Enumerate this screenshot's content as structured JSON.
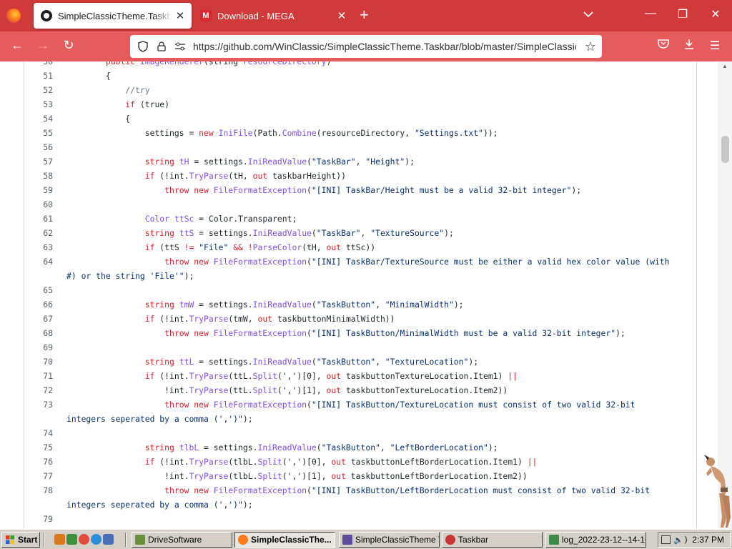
{
  "browser": {
    "tabs": [
      {
        "title": "SimpleClassicTheme.Taskbar/ImageRenderer",
        "active": true
      },
      {
        "title": "Download - MEGA",
        "active": false
      }
    ],
    "url": "https://github.com/WinClassic/SimpleClassicTheme.Taskbar/blob/master/SimpleClassicTheme.Taskbar/",
    "url_host": "https://github.com",
    "url_path": "/WinClassic/SimpleClassicTheme.Taskbar/blob/master/SimpleClassicTh"
  },
  "code": [
    {
      "n": "50",
      "segs": [
        [
          "        public ",
          "kw"
        ],
        [
          "ImageRenderer",
          "mt"
        ],
        [
          "(string ",
          "t"
        ],
        [
          "resourceDirectory",
          "ty"
        ],
        [
          ")",
          "t"
        ]
      ]
    },
    {
      "n": "51",
      "segs": [
        [
          "        {",
          "t"
        ]
      ]
    },
    {
      "n": "52",
      "segs": [
        [
          "            //try",
          "cm"
        ]
      ]
    },
    {
      "n": "53",
      "segs": [
        [
          "            ",
          "t"
        ],
        [
          "if",
          "kw"
        ],
        [
          " (true)",
          "t"
        ]
      ]
    },
    {
      "n": "54",
      "segs": [
        [
          "            {",
          "t"
        ]
      ]
    },
    {
      "n": "55",
      "segs": [
        [
          "                settings = ",
          "t"
        ],
        [
          "new ",
          "kw"
        ],
        [
          "IniFile",
          "mt"
        ],
        [
          "(Path.",
          "t"
        ],
        [
          "Combine",
          "mt"
        ],
        [
          "(resourceDirectory, ",
          "t"
        ],
        [
          "\"Settings.txt\"",
          "st"
        ],
        [
          "));",
          "t"
        ]
      ]
    },
    {
      "n": "56",
      "segs": []
    },
    {
      "n": "57",
      "segs": [
        [
          "                ",
          "t"
        ],
        [
          "string ",
          "kw"
        ],
        [
          "tH",
          "ty"
        ],
        [
          " = settings.",
          "t"
        ],
        [
          "IniReadValue",
          "mt"
        ],
        [
          "(",
          "t"
        ],
        [
          "\"TaskBar\"",
          "st"
        ],
        [
          ", ",
          "t"
        ],
        [
          "\"Height\"",
          "st"
        ],
        [
          ");",
          "t"
        ]
      ]
    },
    {
      "n": "58",
      "segs": [
        [
          "                ",
          "t"
        ],
        [
          "if",
          "kw"
        ],
        [
          " (!int.",
          "t"
        ],
        [
          "TryParse",
          "mt"
        ],
        [
          "(tH, ",
          "t"
        ],
        [
          "out ",
          "kw"
        ],
        [
          "taskbarHeight))",
          "t"
        ]
      ]
    },
    {
      "n": "59",
      "segs": [
        [
          "                    ",
          "t"
        ],
        [
          "throw new ",
          "kw"
        ],
        [
          "FileFormatException",
          "mt"
        ],
        [
          "(",
          "t"
        ],
        [
          "\"[INI] TaskBar/Height must be a valid 32-bit integer\"",
          "st"
        ],
        [
          ");",
          "t"
        ]
      ]
    },
    {
      "n": "60",
      "segs": []
    },
    {
      "n": "61",
      "segs": [
        [
          "                ",
          "t"
        ],
        [
          "Color ",
          "ty"
        ],
        [
          "ttSc",
          "ty"
        ],
        [
          " = Color.Transparent;",
          "t"
        ]
      ]
    },
    {
      "n": "62",
      "segs": [
        [
          "                ",
          "t"
        ],
        [
          "string ",
          "kw"
        ],
        [
          "ttS",
          "ty"
        ],
        [
          " = settings.",
          "t"
        ],
        [
          "IniReadValue",
          "mt"
        ],
        [
          "(",
          "t"
        ],
        [
          "\"TaskBar\"",
          "st"
        ],
        [
          ", ",
          "t"
        ],
        [
          "\"TextureSource\"",
          "st"
        ],
        [
          ");",
          "t"
        ]
      ]
    },
    {
      "n": "63",
      "segs": [
        [
          "                ",
          "t"
        ],
        [
          "if",
          "kw"
        ],
        [
          " (ttS ",
          "t"
        ],
        [
          "!=",
          "kw"
        ],
        [
          " ",
          "t"
        ],
        [
          "\"File\"",
          "st"
        ],
        [
          " ",
          "t"
        ],
        [
          "&&",
          "kw"
        ],
        [
          " ",
          "t"
        ],
        [
          "!",
          "kw"
        ],
        [
          "ParseColor",
          "mt"
        ],
        [
          "(tH, ",
          "t"
        ],
        [
          "out ",
          "kw"
        ],
        [
          "ttSc))",
          "t"
        ]
      ]
    },
    {
      "n": "64",
      "segs": [
        [
          "                    ",
          "t"
        ],
        [
          "throw new ",
          "kw"
        ],
        [
          "FileFormatException",
          "mt"
        ],
        [
          "(",
          "t"
        ],
        [
          "\"[INI] TaskBar/TextureSource must be either a valid hex color value (with",
          "st"
        ]
      ]
    },
    {
      "n": "",
      "segs": [
        [
          "#) or the string 'File'\"",
          "st"
        ],
        [
          ");",
          "t"
        ]
      ],
      "wrap": true
    },
    {
      "n": "65",
      "segs": []
    },
    {
      "n": "66",
      "segs": [
        [
          "                ",
          "t"
        ],
        [
          "string ",
          "kw"
        ],
        [
          "tmW",
          "ty"
        ],
        [
          " = settings.",
          "t"
        ],
        [
          "IniReadValue",
          "mt"
        ],
        [
          "(",
          "t"
        ],
        [
          "\"TaskButton\"",
          "st"
        ],
        [
          ", ",
          "t"
        ],
        [
          "\"MinimalWidth\"",
          "st"
        ],
        [
          ");",
          "t"
        ]
      ]
    },
    {
      "n": "67",
      "segs": [
        [
          "                ",
          "t"
        ],
        [
          "if",
          "kw"
        ],
        [
          " (!int.",
          "t"
        ],
        [
          "TryParse",
          "mt"
        ],
        [
          "(tmW, ",
          "t"
        ],
        [
          "out ",
          "kw"
        ],
        [
          "taskbuttonMinimalWidth))",
          "t"
        ]
      ]
    },
    {
      "n": "68",
      "segs": [
        [
          "                    ",
          "t"
        ],
        [
          "throw new ",
          "kw"
        ],
        [
          "FileFormatException",
          "mt"
        ],
        [
          "(",
          "t"
        ],
        [
          "\"[INI] TaskButton/MinimalWidth must be a valid 32-bit integer\"",
          "st"
        ],
        [
          ");",
          "t"
        ]
      ]
    },
    {
      "n": "69",
      "segs": []
    },
    {
      "n": "70",
      "segs": [
        [
          "                ",
          "t"
        ],
        [
          "string ",
          "kw"
        ],
        [
          "ttL",
          "ty"
        ],
        [
          " = settings.",
          "t"
        ],
        [
          "IniReadValue",
          "mt"
        ],
        [
          "(",
          "t"
        ],
        [
          "\"TaskButton\"",
          "st"
        ],
        [
          ", ",
          "t"
        ],
        [
          "\"TextureLocation\"",
          "st"
        ],
        [
          ");",
          "t"
        ]
      ]
    },
    {
      "n": "71",
      "segs": [
        [
          "                ",
          "t"
        ],
        [
          "if",
          "kw"
        ],
        [
          " (!int.",
          "t"
        ],
        [
          "TryParse",
          "mt"
        ],
        [
          "(ttL.",
          "t"
        ],
        [
          "Split",
          "mt"
        ],
        [
          "(','",
          "t"
        ],
        [
          ")[0], ",
          "t"
        ],
        [
          "out ",
          "kw"
        ],
        [
          "taskbuttonTextureLocation.Item1) ",
          "t"
        ],
        [
          "||",
          "kw"
        ]
      ]
    },
    {
      "n": "72",
      "segs": [
        [
          "                    !int.",
          "t"
        ],
        [
          "TryParse",
          "mt"
        ],
        [
          "(ttL.",
          "t"
        ],
        [
          "Split",
          "mt"
        ],
        [
          "(',')[1], ",
          "t"
        ],
        [
          "out ",
          "kw"
        ],
        [
          "taskbuttonTextureLocation.Item2))",
          "t"
        ]
      ]
    },
    {
      "n": "73",
      "segs": [
        [
          "                    ",
          "t"
        ],
        [
          "throw new ",
          "kw"
        ],
        [
          "FileFormatException",
          "mt"
        ],
        [
          "(",
          "t"
        ],
        [
          "\"[INI] TaskButton/TextureLocation must consist of two valid 32-bit",
          "st"
        ]
      ]
    },
    {
      "n": "",
      "segs": [
        [
          "integers seperated by a comma (',')\"",
          "st"
        ],
        [
          ");",
          "t"
        ]
      ],
      "wrap": true
    },
    {
      "n": "74",
      "segs": []
    },
    {
      "n": "75",
      "segs": [
        [
          "                ",
          "t"
        ],
        [
          "string ",
          "kw"
        ],
        [
          "tlbL",
          "ty"
        ],
        [
          " = settings.",
          "t"
        ],
        [
          "IniReadValue",
          "mt"
        ],
        [
          "(",
          "t"
        ],
        [
          "\"TaskButton\"",
          "st"
        ],
        [
          ", ",
          "t"
        ],
        [
          "\"LeftBorderLocation\"",
          "st"
        ],
        [
          ");",
          "t"
        ]
      ]
    },
    {
      "n": "76",
      "segs": [
        [
          "                ",
          "t"
        ],
        [
          "if",
          "kw"
        ],
        [
          " (!int.",
          "t"
        ],
        [
          "TryParse",
          "mt"
        ],
        [
          "(tlbL.",
          "t"
        ],
        [
          "Split",
          "mt"
        ],
        [
          "(',')[0], ",
          "t"
        ],
        [
          "out ",
          "kw"
        ],
        [
          "taskbuttonLeftBorderLocation.Item1) ",
          "t"
        ],
        [
          "||",
          "kw"
        ]
      ]
    },
    {
      "n": "77",
      "segs": [
        [
          "                    !int.",
          "t"
        ],
        [
          "TryParse",
          "mt"
        ],
        [
          "(tlbL.",
          "t"
        ],
        [
          "Split",
          "mt"
        ],
        [
          "(',')[1], ",
          "t"
        ],
        [
          "out ",
          "kw"
        ],
        [
          "taskbuttonLeftBorderLocation.Item2))",
          "t"
        ]
      ]
    },
    {
      "n": "78",
      "segs": [
        [
          "                    ",
          "t"
        ],
        [
          "throw new ",
          "kw"
        ],
        [
          "FileFormatException",
          "mt"
        ],
        [
          "(",
          "t"
        ],
        [
          "\"[INI] TaskButton/LeftBorderLocation must consist of two valid 32-bit",
          "st"
        ]
      ]
    },
    {
      "n": "",
      "segs": [
        [
          "integers seperated by a comma (',')\"",
          "st"
        ],
        [
          ");",
          "t"
        ]
      ],
      "wrap": true
    },
    {
      "n": "79",
      "segs": []
    }
  ],
  "taskbar": {
    "start_label": "Start",
    "buttons": [
      {
        "label": "DriveSoftware",
        "pressed": false
      },
      {
        "label": "SimpleClassicThe...",
        "pressed": true
      },
      {
        "label": "SimpleClassicTheme T...",
        "pressed": false
      },
      {
        "label": "Taskbar",
        "pressed": false
      },
      {
        "label": "log_2022-23-12--14-1...",
        "pressed": false
      }
    ],
    "clock": "2:37 PM"
  },
  "colors": {
    "browser_accent": "#d13a3a",
    "navbar": "#e65c5c",
    "keyword": "#cf222e",
    "entity": "#8250df",
    "string": "#0a3069",
    "comment": "#6e7781"
  }
}
